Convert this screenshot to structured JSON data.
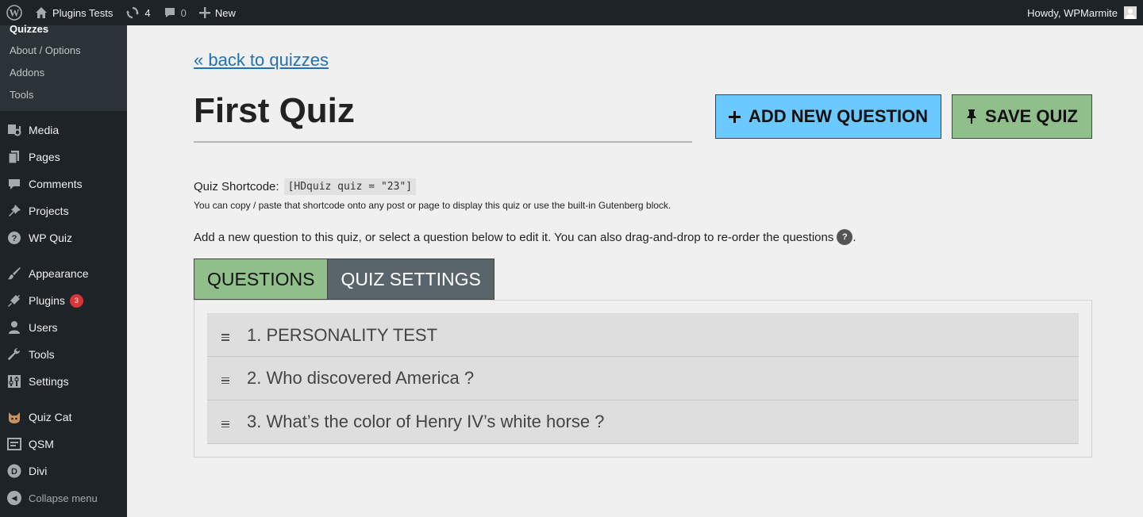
{
  "adminbar": {
    "site_name": "Plugins Tests",
    "updates_count": "4",
    "comments_count": "0",
    "new_label": "New",
    "greeting": "Howdy, WPMarmite"
  },
  "sidebar": {
    "submenu": {
      "current": "Quizzes",
      "items": [
        "About / Options",
        "Addons",
        "Tools"
      ]
    },
    "menu": [
      {
        "label": "Media",
        "icon": "media-icon"
      },
      {
        "label": "Pages",
        "icon": "pages-icon"
      },
      {
        "label": "Comments",
        "icon": "comments-icon"
      },
      {
        "label": "Projects",
        "icon": "pin-icon"
      },
      {
        "label": "WP Quiz",
        "icon": "question-icon"
      },
      {
        "label": "Appearance",
        "icon": "brush-icon"
      },
      {
        "label": "Plugins",
        "icon": "plugin-icon",
        "badge": "3"
      },
      {
        "label": "Users",
        "icon": "user-icon"
      },
      {
        "label": "Tools",
        "icon": "wrench-icon"
      },
      {
        "label": "Settings",
        "icon": "settings-icon"
      },
      {
        "label": "Quiz Cat",
        "icon": "cat-icon"
      },
      {
        "label": "QSM",
        "icon": "qsm-icon"
      },
      {
        "label": "Divi",
        "icon": "divi-icon"
      }
    ],
    "collapse_label": "Collapse menu"
  },
  "main": {
    "back_link": "« back to quizzes",
    "title": "First Quiz",
    "add_question_button": "ADD NEW QUESTION",
    "save_button": "SAVE QUIZ",
    "shortcode_label": "Quiz Shortcode:",
    "shortcode_value": "[HDquiz quiz = \"23\"]",
    "shortcode_help": "You can copy / paste that shortcode onto any post or page to display this quiz or use the built-in Gutenberg block.",
    "instructions": "Add a new question to this quiz, or select a question below to edit it. You can also drag-and-drop to re-order the questions",
    "help_icon_text": "?",
    "instructions_end": ".",
    "tabs": [
      "QUESTIONS",
      "QUIZ SETTINGS"
    ],
    "questions": [
      "1. PERSONALITY TEST",
      "2. Who discovered America ?",
      "3. What’s the color of Henry IV’s white horse ?"
    ]
  },
  "colors": {
    "admin_dark": "#1d2327",
    "link": "#2271b1",
    "add_button": "#6bc9ff",
    "save_button": "#91bf8c",
    "tab_inactive": "#5a646b",
    "badge": "#d63638"
  }
}
